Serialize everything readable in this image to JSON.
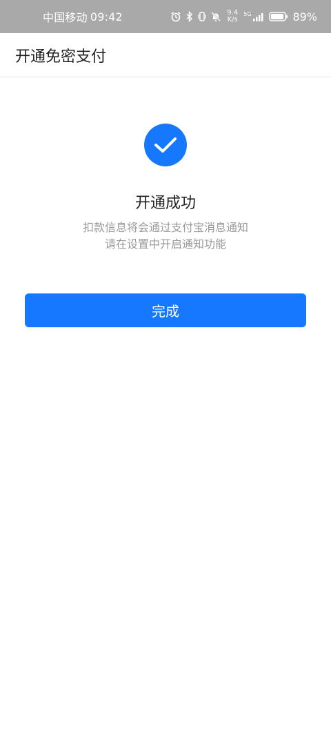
{
  "status_bar": {
    "carrier": "中国移动",
    "time": "09:42",
    "net_speed_value": "9.4",
    "net_speed_unit": "K/s",
    "network_type": "5G",
    "battery": "89%",
    "icons": [
      "alarm-icon",
      "bluetooth-icon",
      "vibrate-icon",
      "mute-bell-icon",
      "signal-icon",
      "battery-icon"
    ]
  },
  "header": {
    "title": "开通免密支付"
  },
  "result": {
    "icon": "checkmark-icon",
    "title": "开通成功",
    "line1": "扣款信息将会通过支付宝消息通知",
    "line2": "请在设置中开启通知功能"
  },
  "actions": {
    "done_label": "完成"
  },
  "colors": {
    "accent": "#1677ff",
    "status_bar_bg": "#a9a9a9"
  }
}
